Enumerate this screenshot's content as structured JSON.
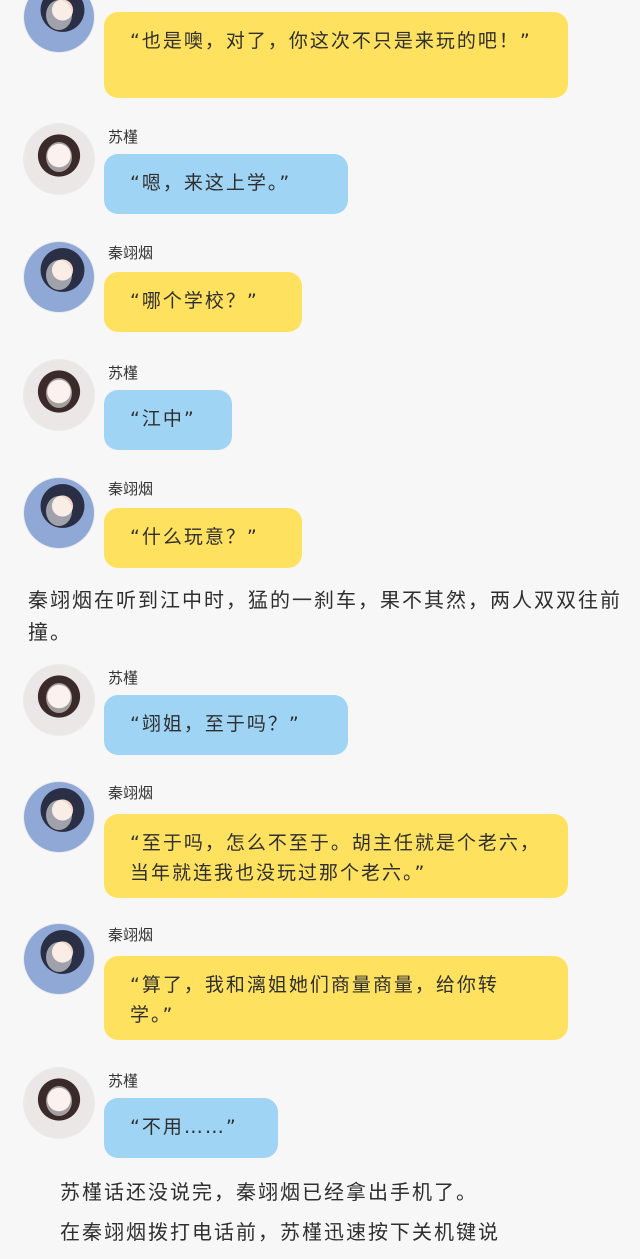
{
  "characters": {
    "qin": "秦翊烟",
    "su": "苏槿"
  },
  "messages": [
    {
      "speaker": "秦翊烟",
      "text": "“也是噢，对了，你这次不只是来玩的吧！”"
    },
    {
      "speaker": "苏槿",
      "text": "“嗯，来这上学。”"
    },
    {
      "speaker": "秦翊烟",
      "text": "“哪个学校？”"
    },
    {
      "speaker": "苏槿",
      "text": "“江中”"
    },
    {
      "speaker": "秦翊烟",
      "text": "“什么玩意？”"
    },
    {
      "speaker": "苏槿",
      "text": "“翊姐，至于吗？”"
    },
    {
      "speaker": "秦翊烟",
      "text": "“至于吗，怎么不至于。胡主任就是个老六，当年就连我也没玩过那个老六。”"
    },
    {
      "speaker": "秦翊烟",
      "text": "“算了，我和漓姐她们商量商量，给你转学。”"
    },
    {
      "speaker": "苏槿",
      "text": "“不用……”"
    }
  ],
  "narration": [
    "秦翊烟在听到江中时，猛的一刹车，果不其然，两人双双往前撞。",
    "苏槿话还没说完，秦翊烟已经拿出手机了。",
    "在秦翊烟拨打电话前，苏槿迅速按下关机键说"
  ],
  "colors": {
    "yellow_bubble": "#ffe160",
    "blue_bubble": "#9fd4f4",
    "background": "#f7f7f7"
  }
}
